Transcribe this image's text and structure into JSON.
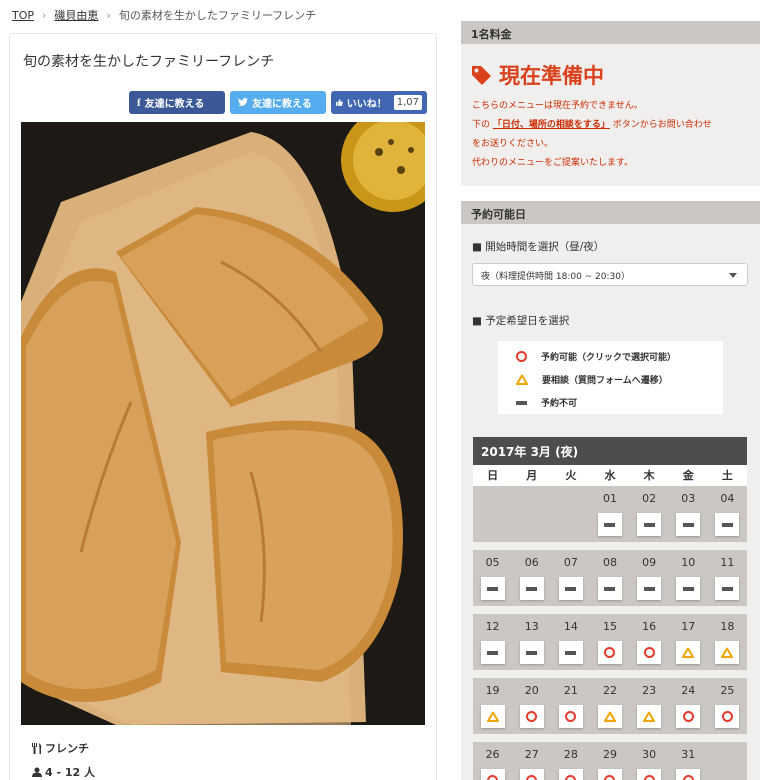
{
  "breadcrumb": {
    "home": "TOP",
    "chef": "磯貝由恵",
    "current": "旬の素材を生かしたファミリーフレンチ"
  },
  "menu": {
    "title": "旬の素材を生かしたファミリーフレンチ",
    "share": {
      "fb_label": "友達に教える",
      "tw_label": "友達に教える",
      "like_label": "いいね！",
      "like_count": "1,07"
    },
    "cuisine": "フレンチ",
    "people": "4 - 12 人"
  },
  "price": {
    "header": "1名料金",
    "status": "現在準備中",
    "notice_line1": "こちらのメニューは現在予約できません。",
    "notice_line2_pre": "下の",
    "notice_line2_link": "「日付、場所の相談をする」",
    "notice_line2_post": "ボタンからお問い合わせ",
    "notice_line3": "をお送りください。",
    "notice_line4": "代わりのメニューをご提案いたします。"
  },
  "availability": {
    "header": "予約可能日",
    "time_label": "■ 開始時間を選択（昼/夜）",
    "time_value": "夜（料理提供時間 18:00 ~ 20:30）",
    "date_label": "■ 予定希望日を選択",
    "legend": [
      {
        "icon": "circle-icon",
        "label": "予約可能（クリックで選択可能）"
      },
      {
        "icon": "triangle-icon",
        "label": "要相談（質問フォームへ遷移）"
      },
      {
        "icon": "bar-icon",
        "label": "予約不可"
      }
    ]
  },
  "calendar": {
    "title": "2017年 3月 (夜)",
    "weekdays": [
      "日",
      "月",
      "火",
      "水",
      "木",
      "金",
      "土"
    ],
    "weeks": [
      [
        null,
        null,
        null,
        {
          "d": "01",
          "s": "ng"
        },
        {
          "d": "02",
          "s": "ng"
        },
        {
          "d": "03",
          "s": "ng"
        },
        {
          "d": "04",
          "s": "ng"
        }
      ],
      [
        {
          "d": "05",
          "s": "ng"
        },
        {
          "d": "06",
          "s": "ng"
        },
        {
          "d": "07",
          "s": "ng"
        },
        {
          "d": "08",
          "s": "ng"
        },
        {
          "d": "09",
          "s": "ng"
        },
        {
          "d": "10",
          "s": "ng"
        },
        {
          "d": "11",
          "s": "ng"
        }
      ],
      [
        {
          "d": "12",
          "s": "ng"
        },
        {
          "d": "13",
          "s": "ng"
        },
        {
          "d": "14",
          "s": "ng"
        },
        {
          "d": "15",
          "s": "ok"
        },
        {
          "d": "16",
          "s": "ok"
        },
        {
          "d": "17",
          "s": "ask"
        },
        {
          "d": "18",
          "s": "ask"
        }
      ],
      [
        {
          "d": "19",
          "s": "ask"
        },
        {
          "d": "20",
          "s": "ok"
        },
        {
          "d": "21",
          "s": "ok"
        },
        {
          "d": "22",
          "s": "ask"
        },
        {
          "d": "23",
          "s": "ask"
        },
        {
          "d": "24",
          "s": "ok"
        },
        {
          "d": "25",
          "s": "ok"
        }
      ],
      [
        {
          "d": "26",
          "s": "ok"
        },
        {
          "d": "27",
          "s": "ok"
        },
        {
          "d": "28",
          "s": "ok"
        },
        {
          "d": "29",
          "s": "ok"
        },
        {
          "d": "30",
          "s": "ok"
        },
        {
          "d": "31",
          "s": "ok"
        },
        null
      ]
    ]
  },
  "colors": {
    "accent": "#d9421c",
    "ok": "#e63b2e",
    "ask": "#f0a500",
    "panel": "#f0efed",
    "panel_head": "#cbc7c2",
    "cal_head": "#4d4d4d"
  }
}
